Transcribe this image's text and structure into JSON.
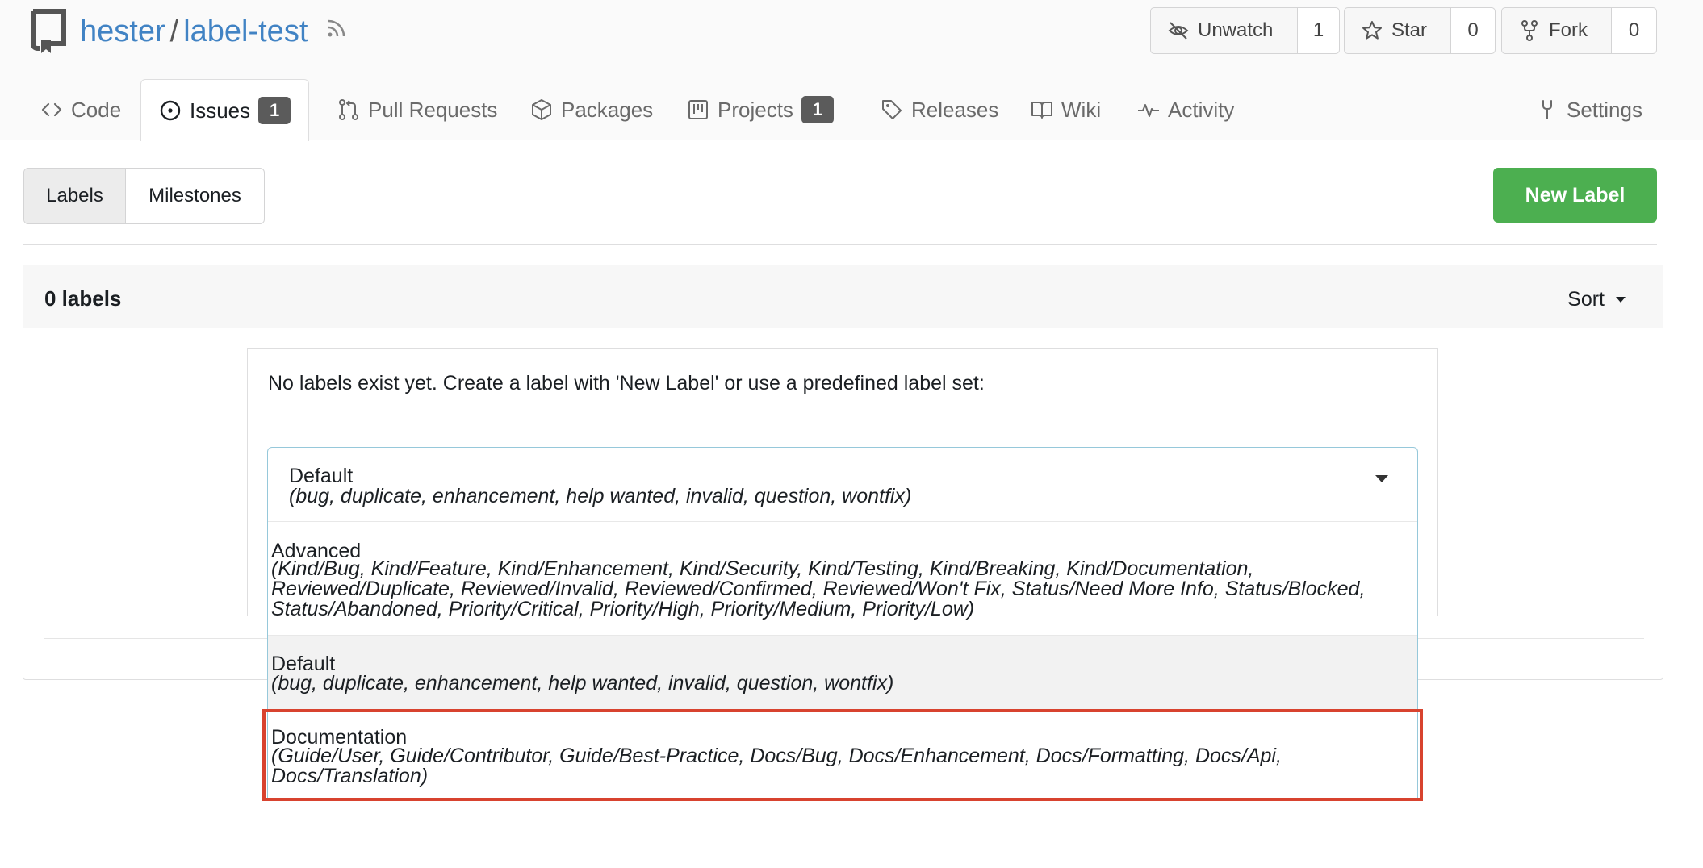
{
  "repo": {
    "owner": "hester",
    "name": "label-test"
  },
  "repo_actions": [
    {
      "label": "Unwatch",
      "count": "1",
      "icon": "eye-slash-icon"
    },
    {
      "label": "Star",
      "count": "0",
      "icon": "star-icon"
    },
    {
      "label": "Fork",
      "count": "0",
      "icon": "fork-icon"
    }
  ],
  "tabs": [
    {
      "label": "Code",
      "icon": "code-icon"
    },
    {
      "label": "Issues",
      "icon": "issue-opened-icon",
      "badge": "1",
      "active": true
    },
    {
      "label": "Pull Requests",
      "icon": "git-pull-request-icon"
    },
    {
      "label": "Packages",
      "icon": "package-icon"
    },
    {
      "label": "Projects",
      "icon": "project-icon",
      "badge": "1"
    },
    {
      "label": "Releases",
      "icon": "tag-icon"
    },
    {
      "label": "Wiki",
      "icon": "book-icon"
    },
    {
      "label": "Activity",
      "icon": "pulse-icon"
    },
    {
      "label": "Settings",
      "icon": "tools-icon"
    }
  ],
  "subnav": {
    "labels": "Labels",
    "milestones": "Milestones"
  },
  "new_label_button": "New Label",
  "panel": {
    "title": "0 labels",
    "sort": "Sort"
  },
  "empty_message": "No labels exist yet. Create a label with 'New Label' or use a predefined label set:",
  "selected": {
    "name": "Default",
    "description": "(bug, duplicate, enhancement, help wanted, invalid, question, wontfix)"
  },
  "options": [
    {
      "name": "Advanced",
      "description_lines": [
        "(Kind/Bug, Kind/Feature, Kind/Enhancement, Kind/Security, Kind/Testing, Kind/Breaking, Kind/Documentation,",
        "Reviewed/Duplicate, Reviewed/Invalid, Reviewed/Confirmed, Reviewed/Won't Fix, Status/Need More Info, Status/Blocked,",
        "Status/Abandoned, Priority/Critical, Priority/High, Priority/Medium, Priority/Low)"
      ]
    },
    {
      "name": "Default",
      "description_lines": [
        "(bug, duplicate, enhancement, help wanted, invalid, question, wontfix)"
      ],
      "selected": true
    },
    {
      "name": "Documentation",
      "description_lines": [
        "(Guide/User, Guide/Contributor, Guide/Best-Practice, Docs/Bug, Docs/Enhancement, Docs/Formatting, Docs/Api,",
        "Docs/Translation)"
      ],
      "highlighted": true
    }
  ],
  "colors": {
    "link": "#4183c4",
    "primary_green": "#4caf50",
    "badge": "#5b5b5b",
    "highlight_border": "#d8432f",
    "dropdown_border": "#96c8da"
  }
}
